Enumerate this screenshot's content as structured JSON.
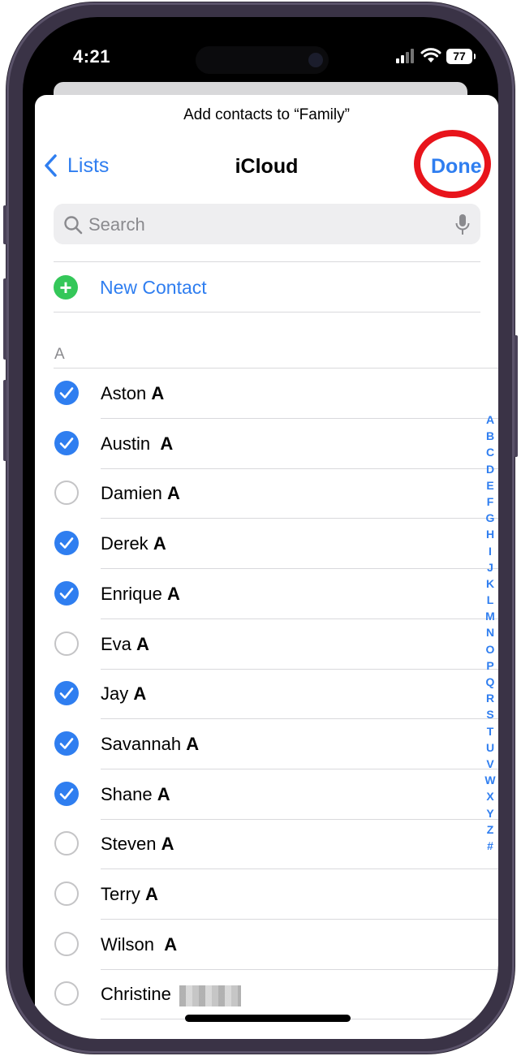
{
  "status": {
    "time": "4:21",
    "battery": "77"
  },
  "sheet_title": "Add contacts to “Family”",
  "nav": {
    "back_label": "Lists",
    "title": "iCloud",
    "done_label": "Done"
  },
  "search": {
    "placeholder": "Search"
  },
  "new_contact_label": "New Contact",
  "section_letter": "A",
  "contacts": [
    {
      "first": "Aston",
      "sep": " ",
      "last": "A",
      "selected": true
    },
    {
      "first": "Austin",
      "sep": "  ",
      "last": "A",
      "selected": true
    },
    {
      "first": "Damien",
      "sep": " ",
      "last": "A",
      "selected": false
    },
    {
      "first": "Derek",
      "sep": " ",
      "last": "A",
      "selected": true
    },
    {
      "first": "Enrique",
      "sep": " ",
      "last": "A",
      "selected": true
    },
    {
      "first": "Eva",
      "sep": " ",
      "last": "A",
      "selected": false
    },
    {
      "first": "Jay",
      "sep": " ",
      "last": "A",
      "selected": true
    },
    {
      "first": "Savannah",
      "sep": " ",
      "last": "A",
      "selected": true
    },
    {
      "first": "Shane",
      "sep": " ",
      "last": "A",
      "selected": true
    },
    {
      "first": "Steven",
      "sep": " ",
      "last": "A",
      "selected": false
    },
    {
      "first": "Terry",
      "sep": " ",
      "last": "A",
      "selected": false
    },
    {
      "first": "Wilson",
      "sep": "  ",
      "last": "A",
      "selected": false
    },
    {
      "first": "Christine",
      "sep": " ",
      "last": "",
      "selected": false,
      "last_redacted": true
    }
  ],
  "index_letters": [
    "A",
    "B",
    "C",
    "D",
    "E",
    "F",
    "G",
    "H",
    "I",
    "J",
    "K",
    "L",
    "M",
    "N",
    "O",
    "P",
    "Q",
    "R",
    "S",
    "T",
    "U",
    "V",
    "W",
    "X",
    "Y",
    "Z",
    "#"
  ],
  "colors": {
    "accent": "#2f7ef0",
    "highlight_ring": "#e8141b",
    "add_green": "#34c759"
  }
}
